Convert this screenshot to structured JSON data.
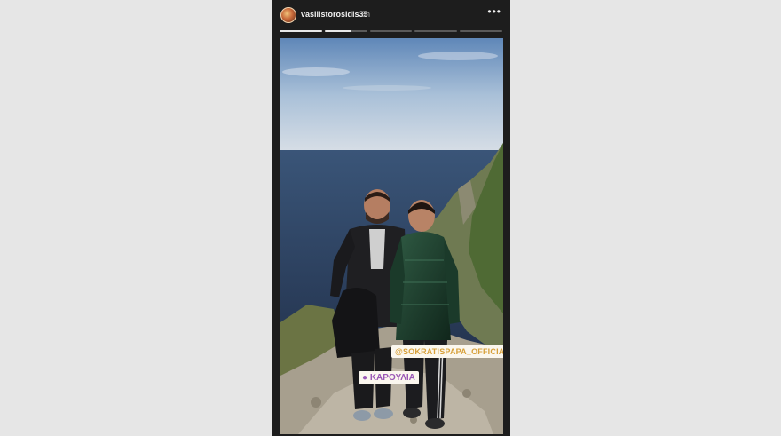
{
  "story": {
    "username": "vasilistorosidis35",
    "time": "8h",
    "more_icon": "more-dots-icon",
    "progress": {
      "segments": 5,
      "completed": 1,
      "current_fraction": 0.6
    },
    "stickers": {
      "mention": "@SOKRATISPAPA_OFFICIAL",
      "location": "ΚΑΡΟΥΛΙΑ"
    }
  },
  "colors": {
    "background": "#e6e6e6",
    "story_frame": "#1d1d1d",
    "mention_text": "#d7a03a",
    "location_text": "#9b59b6"
  }
}
